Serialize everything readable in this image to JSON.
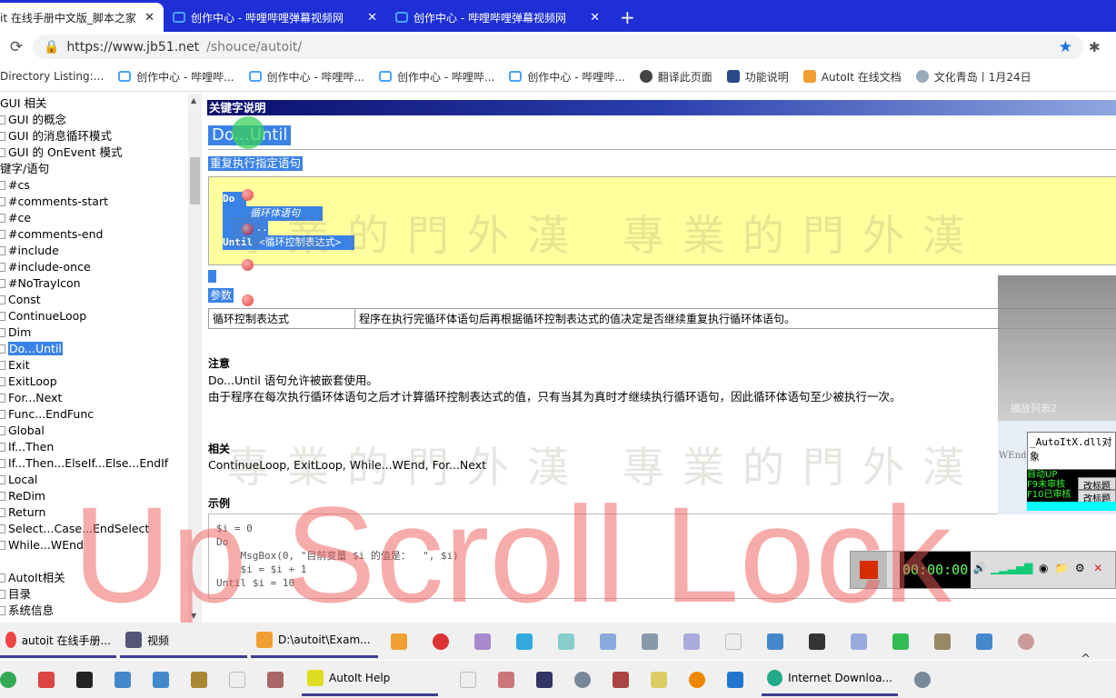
{
  "browser": {
    "tabs": [
      {
        "label": "it 在线手册中文版_脚本之家",
        "active": true
      },
      {
        "label": "创作中心 - 哔哩哔哩弹幕视频网",
        "active": false
      },
      {
        "label": "创作中心 - 哔哩哔哩弹幕视频网",
        "active": false
      }
    ],
    "new_tab": "+",
    "close": "✕",
    "url_host": "https://www.jb51.net",
    "url_path": "/shouce/autoit/",
    "bookmarks": [
      "Directory Listing:...",
      "创作中心 - 哔哩哔...",
      "创作中心 - 哔哩哔...",
      "创作中心 - 哔哩哔...",
      "创作中心 - 哔哩哔...",
      "翻译此页面",
      "功能说明",
      "AutoIt 在线文档",
      "文化青岛丨1月24日"
    ]
  },
  "sidebar": {
    "items": [
      {
        "label": "GUI 相关",
        "level": 0
      },
      {
        "label": "GUI 的概念",
        "level": 1
      },
      {
        "label": "GUI 的消息循环模式",
        "level": 1
      },
      {
        "label": "GUI 的 OnEvent 模式",
        "level": 1
      },
      {
        "label": "键字/语句",
        "level": 0
      },
      {
        "label": "#cs",
        "level": 1
      },
      {
        "label": "#comments-start",
        "level": 1
      },
      {
        "label": "#ce",
        "level": 1
      },
      {
        "label": "#comments-end",
        "level": 1
      },
      {
        "label": "#include",
        "level": 1
      },
      {
        "label": "#include-once",
        "level": 1
      },
      {
        "label": "#NoTrayIcon",
        "level": 1
      },
      {
        "label": "Const",
        "level": 1
      },
      {
        "label": "ContinueLoop",
        "level": 1
      },
      {
        "label": "Dim",
        "level": 1
      },
      {
        "label": "Do...Until",
        "level": 1,
        "selected": true
      },
      {
        "label": "Exit",
        "level": 1
      },
      {
        "label": "ExitLoop",
        "level": 1
      },
      {
        "label": "For...Next",
        "level": 1
      },
      {
        "label": "Func...EndFunc",
        "level": 1
      },
      {
        "label": "Global",
        "level": 1
      },
      {
        "label": "If...Then",
        "level": 1
      },
      {
        "label": "If...Then...ElseIf...Else...EndIf",
        "level": 1
      },
      {
        "label": "Local",
        "level": 1
      },
      {
        "label": "ReDim",
        "level": 1
      },
      {
        "label": "Return",
        "level": 1
      },
      {
        "label": "Select...Case...EndSelect",
        "level": 1
      },
      {
        "label": "While...WEnd",
        "level": 1
      },
      {
        "label": "",
        "level": 0
      },
      {
        "label": "AutoIt相关",
        "level": 1
      },
      {
        "label": "目录",
        "level": 1
      },
      {
        "label": "系统信息",
        "level": 1
      }
    ]
  },
  "main": {
    "header": "关键字说明",
    "title": "Do...Until",
    "subtitle": "重复执行指定语句",
    "syntax": {
      "do": "Do",
      "body": "循环体语句",
      "dots": "...",
      "until": "Until",
      "cond": "<循环控制表达式>"
    },
    "params_title": "参数",
    "params": [
      {
        "name": "循环控制表达式",
        "desc": "程序在执行完循环体语句后再根据循环控制表达式的值决定是否继续重复执行循环体语句。"
      }
    ],
    "notes_title": "注意",
    "notes": [
      "Do...Until 语句允许被嵌套使用。",
      "由于程序在每次执行循环体语句之后才计算循环控制表达式的值，只有当其为真时才继续执行循环语句，因此循环体语句至少被执行一次。"
    ],
    "related_title": "相关",
    "related": "ContinueLoop, ExitLoop, While...WEnd, For...Next",
    "example_title": "示例",
    "example": "$i = 0\nDo\n    MsgBox(0, \"目前变量 $i 的值是：  \", $i)\n    $i = $i + 1\nUntil $i = 10",
    "watermark": "專業的門外漢"
  },
  "overlay_text": "Up Scroll Lock",
  "video": {
    "caption": "播放列表2"
  },
  "autoitx": {
    "text": "_AutoItX.dll对象",
    "wend": "WEnd",
    "lines": [
      "自动UP",
      "F9未审核",
      "F10已审核"
    ],
    "buttons": [
      "改标题",
      "改标题"
    ]
  },
  "recorder": {
    "time": "00:00:00"
  },
  "taskbar": {
    "row1": [
      {
        "label": "autoit 在线手册...",
        "open": true,
        "color": "#e44"
      },
      {
        "label": "视频",
        "open": true,
        "color": "#557"
      },
      {
        "label": "D:\\autoit\\Exam...",
        "open": true,
        "color": "#f0a030"
      }
    ],
    "row2": [
      {
        "label": "AutoIt Help",
        "open": true,
        "color": "#dd2"
      },
      {
        "label": "Internet Downloa...",
        "open": true,
        "color": "#2a8"
      }
    ],
    "tray_chevron": "^"
  },
  "colors": {
    "tabbar": "#1e2fd6",
    "selection": "#3b82e6",
    "syntax_bg": "#ffff9e",
    "overlay": "#f05a5a"
  }
}
